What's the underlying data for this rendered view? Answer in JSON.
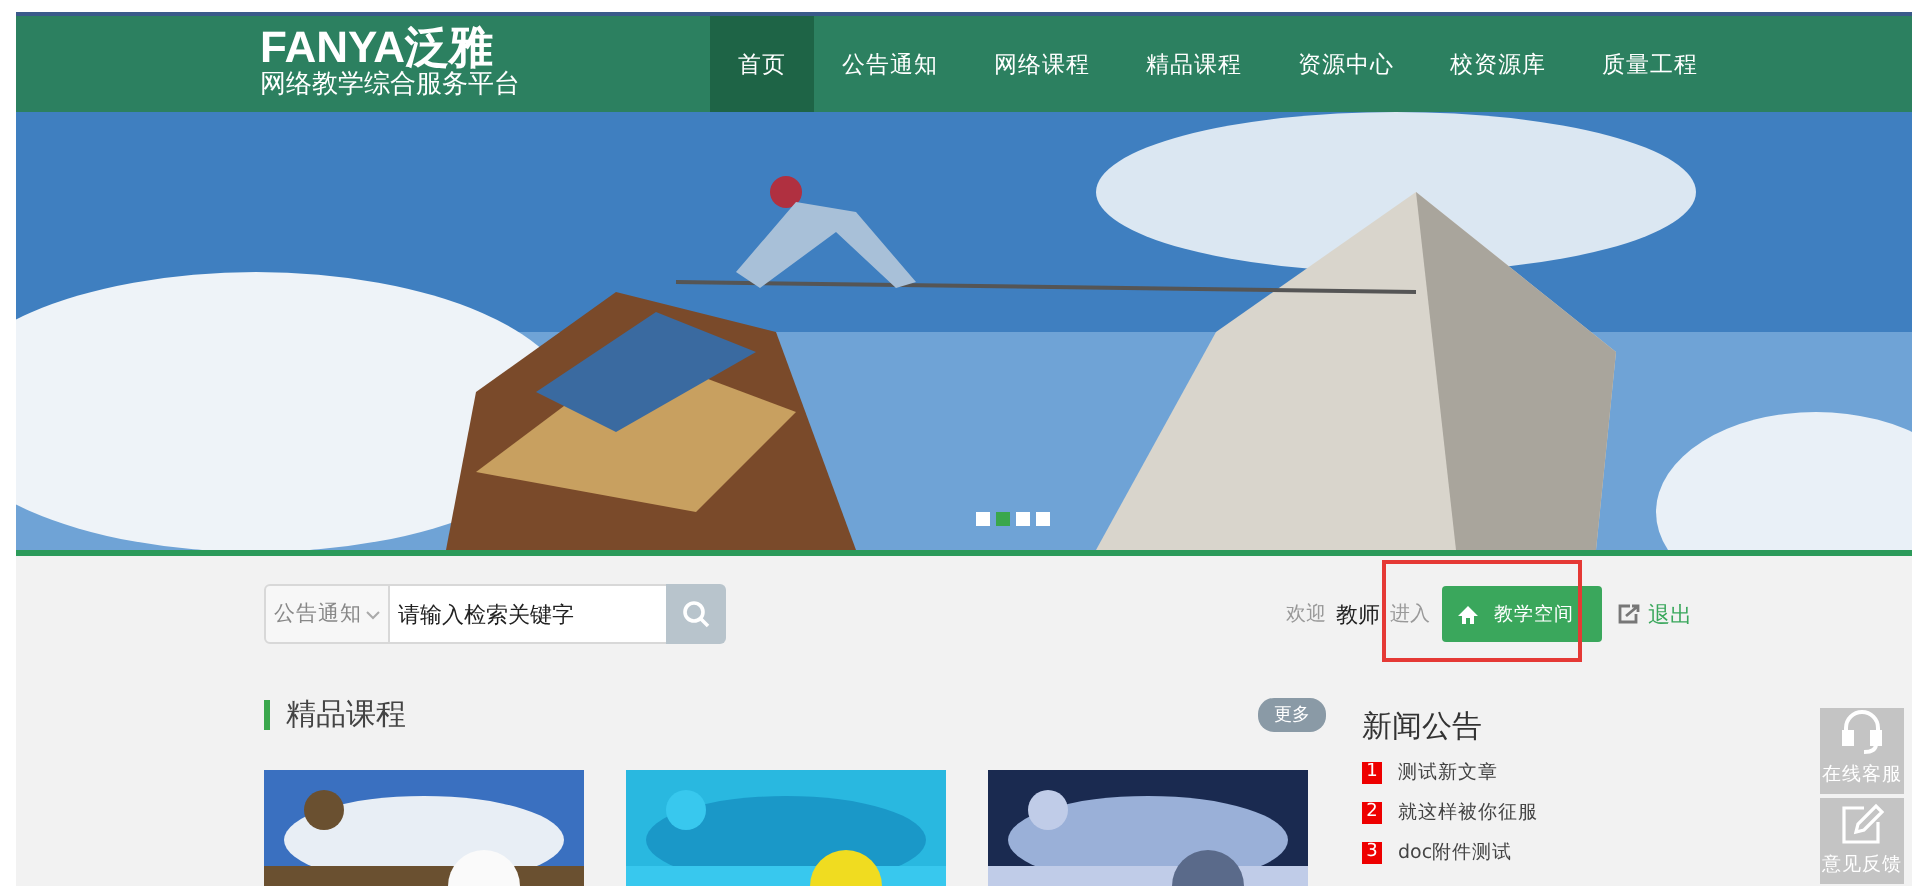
{
  "header": {
    "logo_brand": "FANYA泛雅",
    "logo_subtitle": "网络教学综合服务平台"
  },
  "nav": [
    {
      "label": "首页",
      "selected": true
    },
    {
      "label": "公告通知",
      "selected": false
    },
    {
      "label": "网络课程",
      "selected": false
    },
    {
      "label": "精品课程",
      "selected": false
    },
    {
      "label": "资源中心",
      "selected": false
    },
    {
      "label": "校资源库",
      "selected": false
    },
    {
      "label": "质量工程",
      "selected": false
    }
  ],
  "banner": {
    "kind": "picture",
    "dots": [
      {
        "selected": false
      },
      {
        "selected": true
      },
      {
        "selected": false
      },
      {
        "selected": false
      }
    ]
  },
  "search": {
    "category": "公告通知",
    "placeholder": "请输入检索关键字"
  },
  "user": {
    "welcome": "欢迎",
    "name": "教师",
    "enter": "进入",
    "space_button": "教学空间",
    "logout": "退出"
  },
  "courses": {
    "title": "精品课程",
    "more": "更多"
  },
  "news": {
    "title": "新闻公告",
    "items": [
      {
        "rank": "1",
        "title": "测试新文章"
      },
      {
        "rank": "2",
        "title": "就这样被你征服"
      },
      {
        "rank": "3",
        "title": "doc附件测试"
      }
    ]
  },
  "side_tools": [
    {
      "label": "在线客服",
      "kind": "headset"
    },
    {
      "label": "意见反馈",
      "kind": "edit"
    }
  ]
}
